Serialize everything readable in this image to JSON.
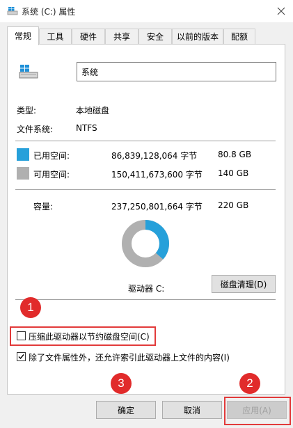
{
  "window": {
    "title": "系统 (C:) 属性"
  },
  "tabs": [
    {
      "label": "常规",
      "active": true
    },
    {
      "label": "工具"
    },
    {
      "label": "硬件"
    },
    {
      "label": "共享"
    },
    {
      "label": "安全"
    },
    {
      "label": "以前的版本"
    },
    {
      "label": "配额"
    }
  ],
  "general": {
    "drive_name": "系统",
    "type_label": "类型:",
    "type_value": "本地磁盘",
    "fs_label": "文件系统:",
    "fs_value": "NTFS",
    "used": {
      "label": "已用空间:",
      "bytes": "86,839,128,064 字节",
      "size": "80.8 GB"
    },
    "free": {
      "label": "可用空间:",
      "bytes": "150,411,673,600 字节",
      "size": "140 GB"
    },
    "capacity": {
      "label": "容量:",
      "bytes": "237,250,801,664 字节",
      "size": "220 GB"
    },
    "drive_caption": "驱动器 C:",
    "cleanup_button": "磁盘清理(D)",
    "compress_label": "压缩此驱动器以节约磁盘空间(C)",
    "compress_checked": false,
    "index_label": "除了文件属性外，还允许索引此驱动器上文件的内容(I)",
    "index_checked": true,
    "used_fraction": 0.366
  },
  "footer": {
    "ok": "确定",
    "cancel": "取消",
    "apply": "应用(A)"
  },
  "annotations": [
    "1",
    "2",
    "3"
  ],
  "colors": {
    "used": "#26a0da",
    "free": "#b0b0b0",
    "highlight": "#e23a3a"
  }
}
